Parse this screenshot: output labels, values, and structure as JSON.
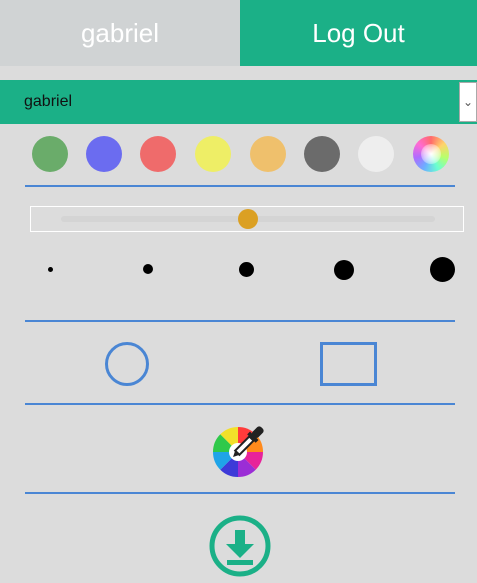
{
  "header": {
    "username": "gabriel",
    "logout_label": "Log Out"
  },
  "user_select": {
    "selected": "gabriel"
  },
  "palette": {
    "colors": [
      "#6aac6a",
      "#6b6cf0",
      "#ef6b6b",
      "#eeee66",
      "#efc06c",
      "#6b6b6b",
      "#eeeeee"
    ],
    "custom_icon": "color-wheel-icon"
  },
  "brush_size": {
    "level": 0.5,
    "dot_sizes": [
      "xs",
      "s",
      "m",
      "l",
      "xl"
    ]
  },
  "shapes": {
    "items": [
      "circle-icon",
      "rectangle-icon"
    ]
  },
  "tools": {
    "color_picker_icon": "eyedropper-color-wheel-icon",
    "download_icon": "download-icon"
  },
  "theme": {
    "accent": "#1bb087",
    "divider": "#4a86d4",
    "slider_thumb": "#dba023"
  }
}
